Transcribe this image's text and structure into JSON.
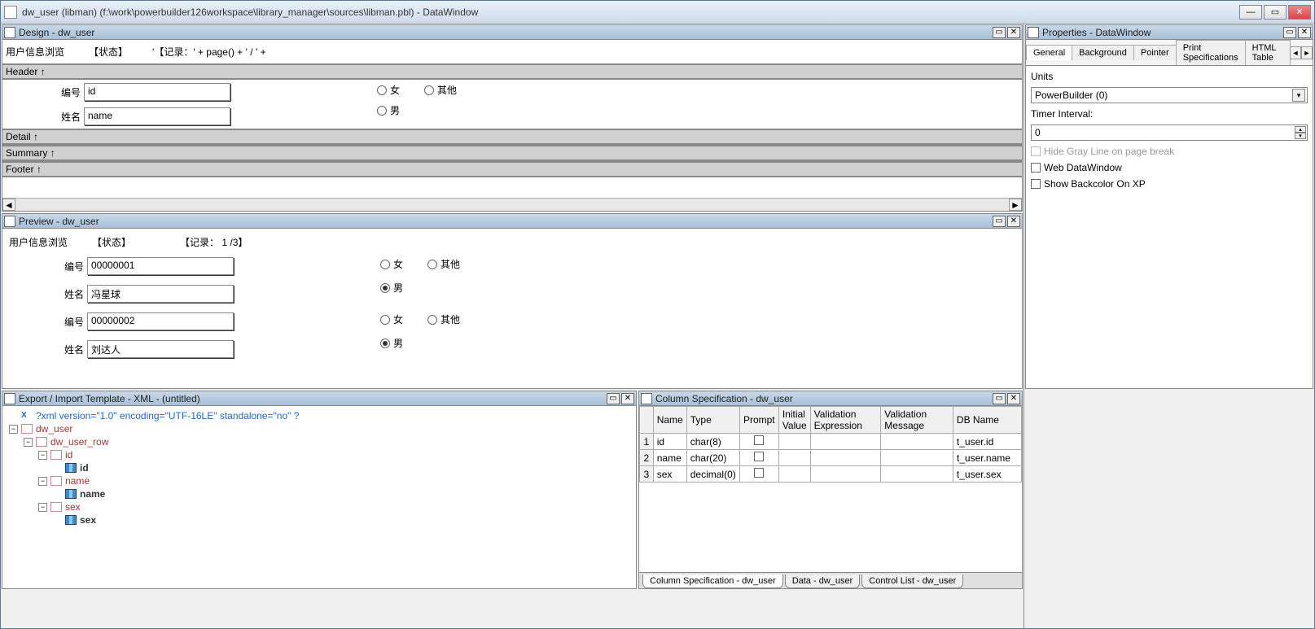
{
  "titlebar": {
    "text": "dw_user  (libman)  (f:\\work\\powerbuilder126workspace\\library_manager\\sources\\libman.pbl) - DataWindow"
  },
  "panels": {
    "design": "Design - dw_user",
    "preview": "Preview - dw_user",
    "xml": "Export / Import Template - XML - (untitled)",
    "colspec": "Column Specification - dw_user",
    "properties": "Properties - DataWindow"
  },
  "design": {
    "title": "用户信息浏览",
    "status": "【状态】",
    "page_expr": "'【记录：' + page() + ' / ' +",
    "bands": {
      "header": "Header ↑",
      "detail": "Detail ↑",
      "summary": "Summary ↑",
      "footer": "Footer ↑"
    },
    "labels": {
      "id": "编号",
      "name": "姓名"
    },
    "fields": {
      "id": "id",
      "name": "name"
    },
    "radios": {
      "female": "女",
      "other": "其他",
      "male": "男"
    }
  },
  "preview": {
    "title": "用户信息浏览",
    "status": "【状态】",
    "page_info": "【记录： 1 /3】",
    "labels": {
      "id": "编号",
      "name": "姓名"
    },
    "records": [
      {
        "id": "00000001",
        "name": "冯星球",
        "sex": "male"
      },
      {
        "id": "00000002",
        "name": "刘达人",
        "sex": "male"
      }
    ],
    "radios": {
      "female": "女",
      "other": "其他",
      "male": "男"
    }
  },
  "xml_tree": {
    "decl": "?xml version=\"1.0\" encoding=\"UTF-16LE\" standalone=\"no\" ?",
    "root": "dw_user",
    "row": "dw_user_row",
    "nodes": [
      {
        "elem": "id",
        "col": "id"
      },
      {
        "elem": "name",
        "col": "name"
      },
      {
        "elem": "sex",
        "col": "sex"
      }
    ]
  },
  "colspec": {
    "headers": {
      "name": "Name",
      "type": "Type",
      "prompt": "Prompt",
      "initial": "Initial Value",
      "validation_expr": "Validation Expression",
      "validation_msg": "Validation Message",
      "dbname": "DB Name"
    },
    "rows": [
      {
        "n": "1",
        "name": "id",
        "type": "char(8)",
        "dbname": "t_user.id"
      },
      {
        "n": "2",
        "name": "name",
        "type": "char(20)",
        "dbname": "t_user.name"
      },
      {
        "n": "3",
        "name": "sex",
        "type": "decimal(0)",
        "dbname": "t_user.sex"
      }
    ],
    "tabs": {
      "colspec": "Column Specification - dw_user",
      "data": "Data - dw_user",
      "control": "Control List - dw_user"
    }
  },
  "properties": {
    "tabs": {
      "general": "General",
      "background": "Background",
      "pointer": "Pointer",
      "print": "Print Specifications",
      "html": "HTML Table"
    },
    "units_label": "Units",
    "units_value": "PowerBuilder (0)",
    "timer_label": "Timer Interval:",
    "timer_value": "0",
    "hide_gray": "Hide Gray Line on page break",
    "web_dw": "Web DataWindow",
    "backcolor_xp": "Show Backcolor On XP"
  }
}
